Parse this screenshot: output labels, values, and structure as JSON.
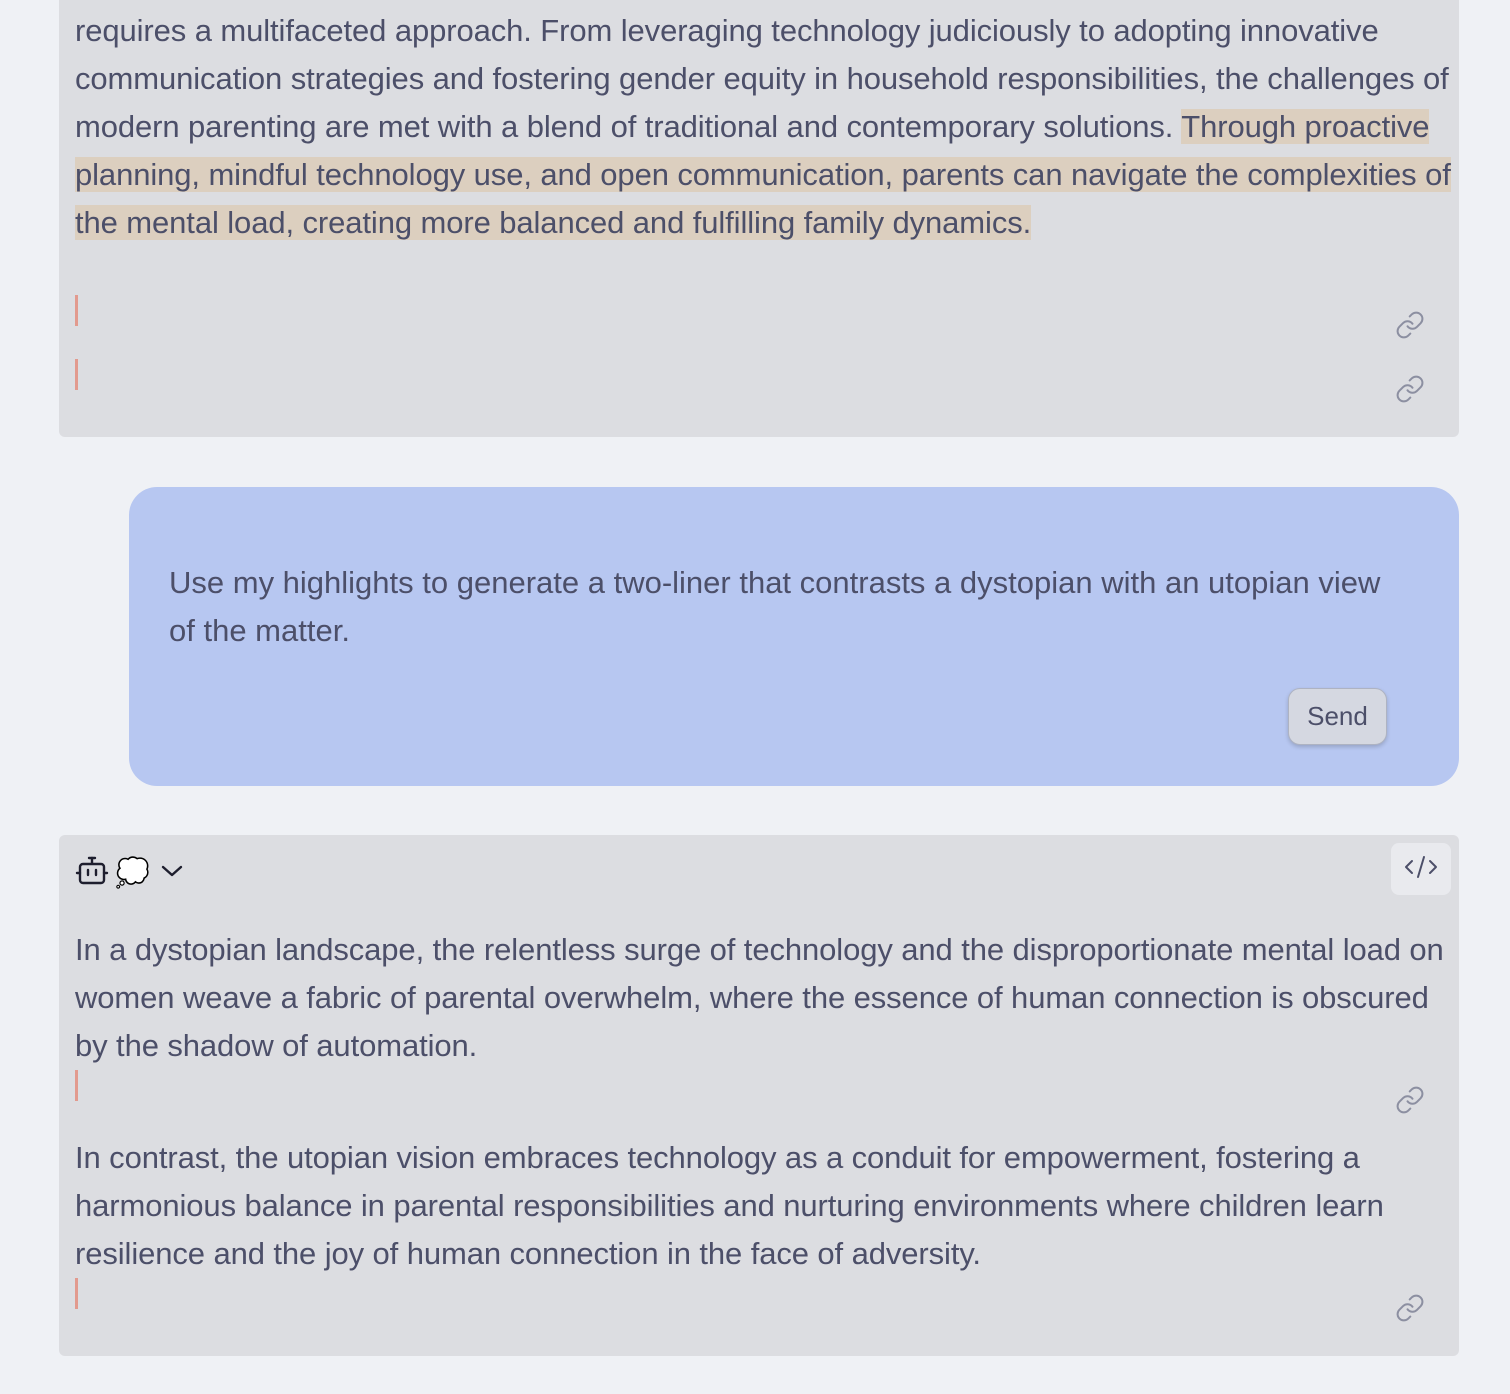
{
  "previous_response": {
    "paragraph_plain": "requires a multifaceted approach. From leveraging technology judiciously to adopting innovative communication strategies and fostering gender equity in household responsibilities, the challenges of modern parenting are met with a blend of traditional and contemporary solutions. ",
    "paragraph_highlight": "Through proactive planning, mindful technology use, and open communication, parents can navigate the complexities of the mental load, creating more balanced and fulfilling family dynamics."
  },
  "user_message": {
    "text": "Use my highlights to generate a two-liner that contrasts a dystopian with an utopian view of the matter.",
    "send_label": "Send"
  },
  "assistant_response": {
    "icons": [
      "robot-icon",
      "thought-bubble-icon",
      "chevron-down-icon",
      "code-icon"
    ],
    "thought_glyph": "💭",
    "paragraphs": [
      "In a dystopian landscape, the relentless surge of technology and the disproportionate mental load on women weave a fabric of parental overwhelm, where the essence of human connection is obscured by the shadow of automation.",
      "In contrast, the utopian vision embraces technology as a conduit for empowerment, fostering a harmonious balance in parental responsibilities and nurturing environments where children learn resilience and the joy of human connection in the face of adversity."
    ]
  },
  "colors": {
    "page_bg": "#eff1f5",
    "card_bg": "#dcdde1",
    "user_bubble_bg": "#b7c7f1",
    "highlight_bg": "#dccfbf",
    "margin_mark": "#e29a8e",
    "text": "#4c4f69"
  }
}
